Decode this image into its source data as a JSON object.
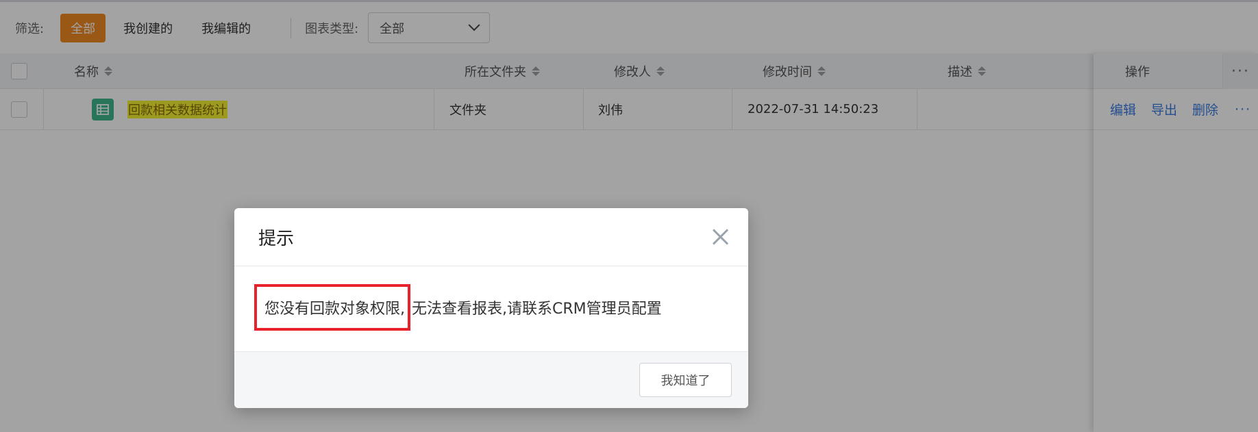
{
  "filter": {
    "label": "筛选:",
    "chips": [
      "全部",
      "我创建的",
      "我编辑的"
    ],
    "active_chip": "全部",
    "type_label": "图表类型:",
    "type_value": "全部"
  },
  "table": {
    "headers": {
      "name": "名称",
      "folder": "所在文件夹",
      "modifier": "修改人",
      "modified_time": "修改时间",
      "description": "描述",
      "actions": "操作",
      "more": "···"
    },
    "rows": [
      {
        "name": "回款相关数据统计",
        "folder": "文件夹",
        "modifier": "刘伟",
        "modified_time": "2022-07-31 14:50:23",
        "description": "",
        "actions": [
          "编辑",
          "导出",
          "删除"
        ],
        "more": "···"
      }
    ]
  },
  "dialog": {
    "title": "提示",
    "message_highlighted": "您没有回款对象权限,",
    "message_rest": "无法查看报表,请联系CRM管理员配置",
    "ok_label": "我知道了"
  },
  "colors": {
    "accent": "#f08a22",
    "link": "#3a7be0",
    "highlight_box": "#e8222a",
    "report_icon": "#3fb78d",
    "row_highlight": "#f5f233"
  }
}
